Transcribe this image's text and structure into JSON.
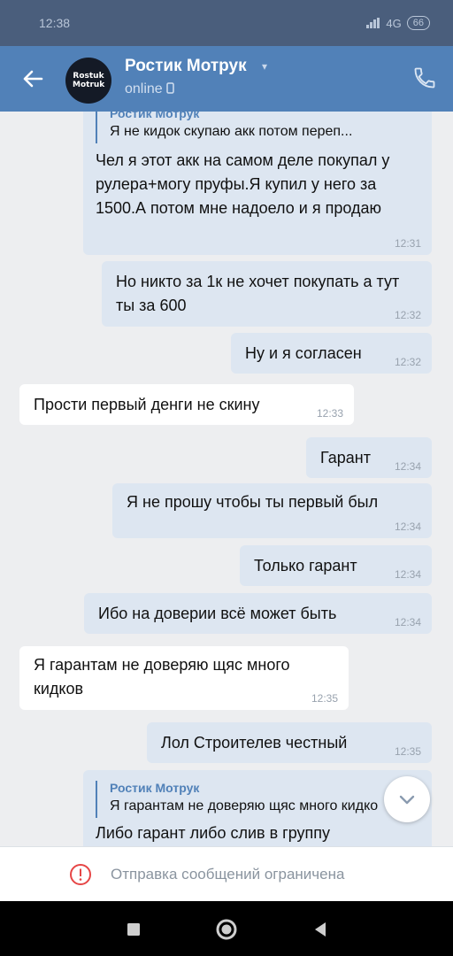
{
  "status": {
    "time": "12:38",
    "network": "4G",
    "battery": "66"
  },
  "header": {
    "name": "Ростик Мотрук",
    "status": "online",
    "avatar_text": "Rostuk Motruk"
  },
  "messages": [
    {
      "quote_name": "Ростик Мотрук",
      "quote_text": "Я не кидок скупаю акк потом переп...",
      "text": "Чел я этот акк на самом деле покупал у рулера+могу пруфы.Я купил у него за 1500.А потом мне надоело и я продаю",
      "time": "12:31"
    },
    {
      "text": "Но никто за 1к не хочет покупать а тут ты за 600",
      "time": "12:32"
    },
    {
      "text": "Ну и я согласен",
      "time": "12:32"
    },
    {
      "text": "Прости первый денги не скину",
      "time": "12:33"
    },
    {
      "text": "Гарант",
      "time": "12:34"
    },
    {
      "text": "Я не прошу чтобы ты первый был",
      "time": "12:34"
    },
    {
      "text": "Только гарант",
      "time": "12:34"
    },
    {
      "text": "Ибо на доверии всё может быть",
      "time": "12:34"
    },
    {
      "text": "Я гарантам не доверяю щяс много кидков",
      "time": "12:35"
    },
    {
      "text": "Лол Строителев честный",
      "time": "12:35"
    },
    {
      "quote_name": "Ростик Мотрук",
      "quote_text": "Я гарантам не доверяю щяс много кидков",
      "text": "Либо гарант либо слив в группу"
    }
  ],
  "notice": "Отправка сообщений ограничена",
  "colors": {
    "header": "#5181b8",
    "chat_bg": "#edeef0",
    "outgoing": "#dde6f1",
    "incoming": "#ffffff"
  },
  "icons": {
    "back": "arrow-left-icon",
    "phone": "phone-icon",
    "scroll": "chevron-down-icon",
    "notice": "alert-circle-icon"
  }
}
